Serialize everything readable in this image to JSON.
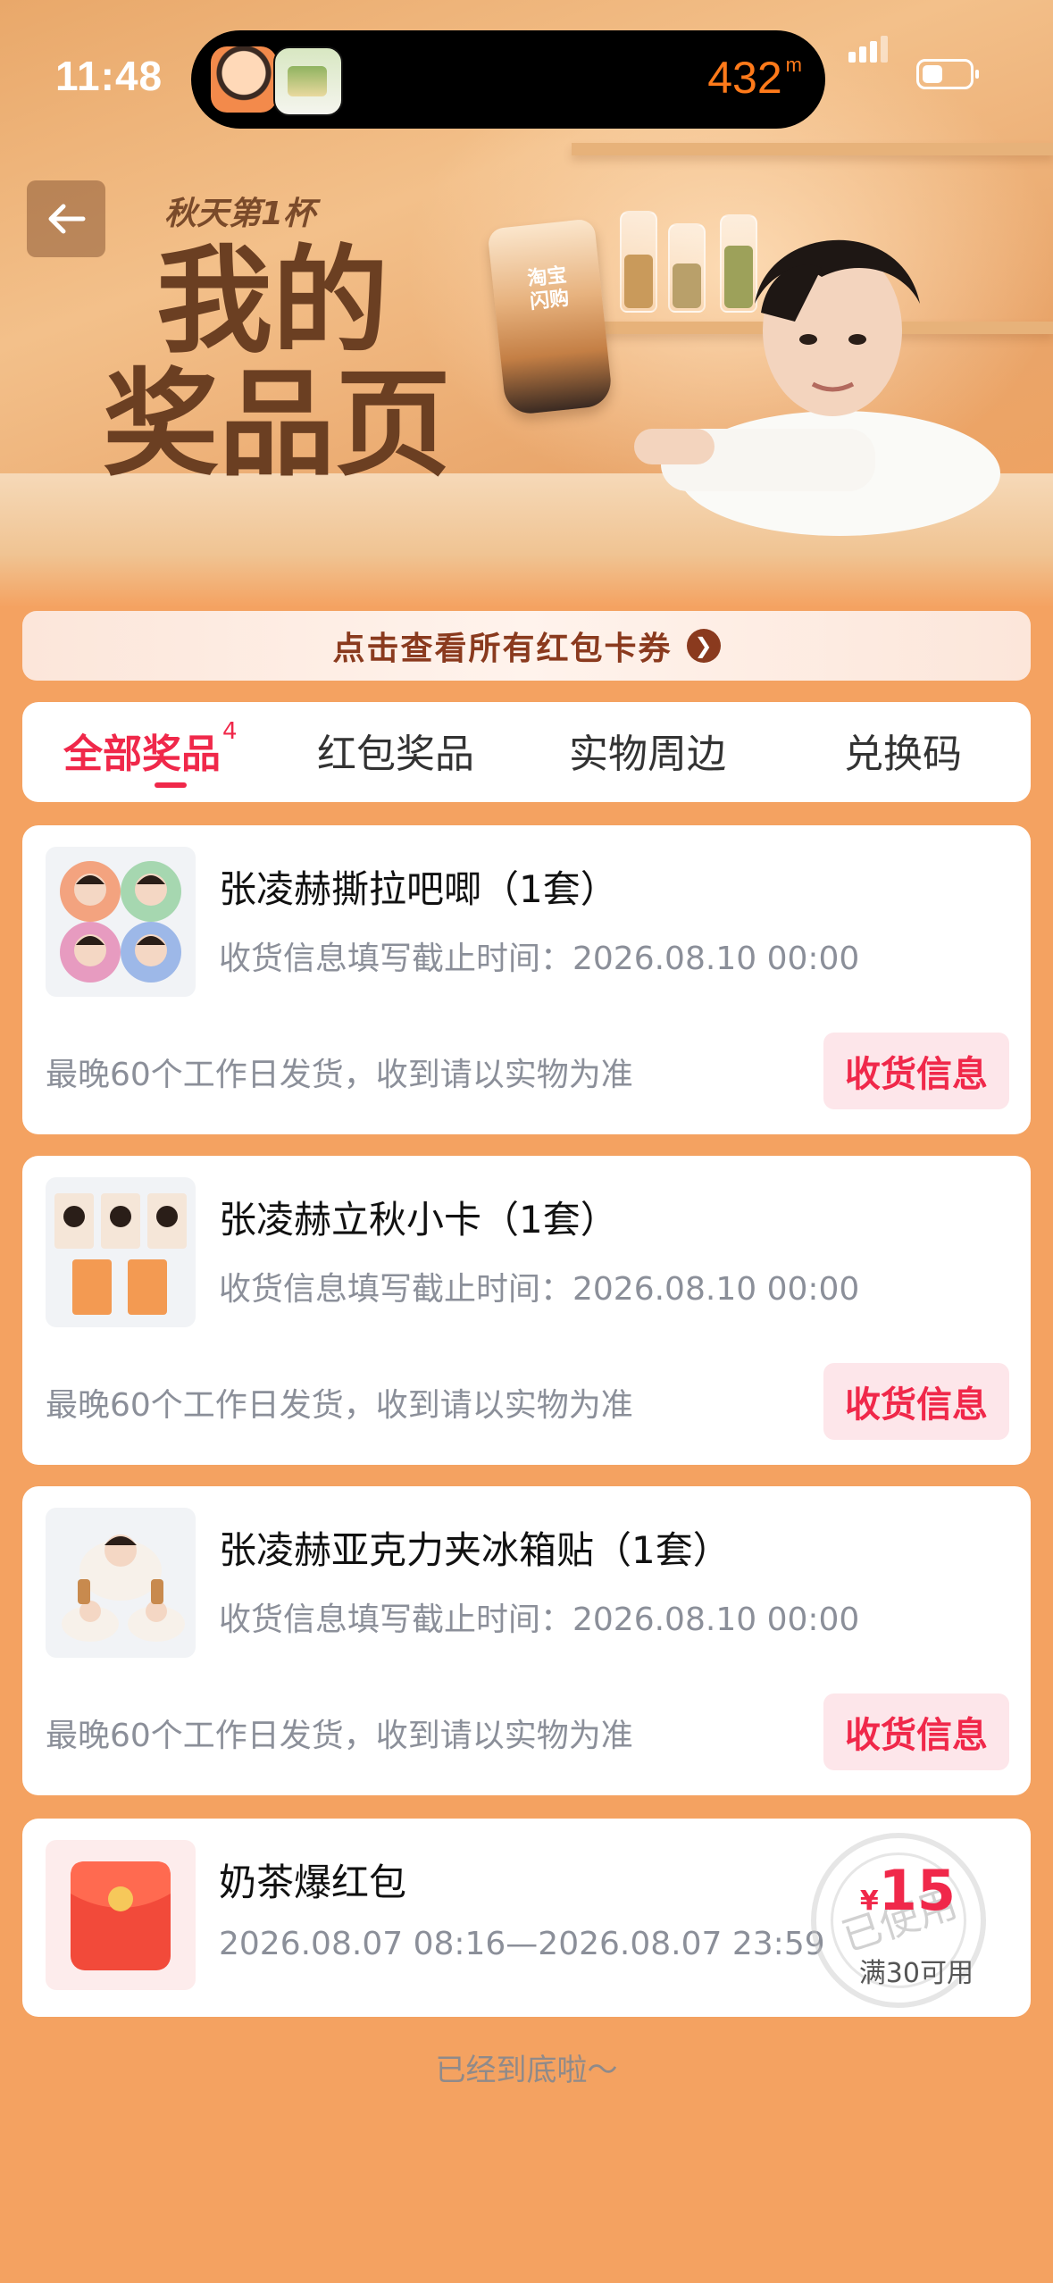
{
  "status_bar": {
    "time": "11:48",
    "distance": "432",
    "distance_unit": "m"
  },
  "hero": {
    "subtitle": "秋天第1杯",
    "title_line1": "我的",
    "title_line2": "奖品页",
    "cup_label_line1": "淘宝",
    "cup_label_line2": "闪购"
  },
  "coupon_banner": {
    "label": "点击查看所有红包卡券"
  },
  "tabs": [
    {
      "label": "全部奖品",
      "badge": "4"
    },
    {
      "label": "红包奖品"
    },
    {
      "label": "实物周边"
    },
    {
      "label": "兑换码"
    }
  ],
  "prizes": [
    {
      "title": "张凌赫撕拉吧唧（1套）",
      "deadline": "收货信息填写截止时间：2026.08.10 00:00",
      "ship_note": "最晚60个工作日发货，收到请以实物为准",
      "button": "收货信息"
    },
    {
      "title": "张凌赫立秋小卡（1套）",
      "deadline": "收货信息填写截止时间：2026.08.10 00:00",
      "ship_note": "最晚60个工作日发货，收到请以实物为准",
      "button": "收货信息"
    },
    {
      "title": "张凌赫亚克力夹冰箱贴（1套）",
      "deadline": "收货信息填写截止时间：2026.08.10 00:00",
      "ship_note": "最晚60个工作日发货，收到请以实物为准",
      "button": "收货信息"
    }
  ],
  "redpacket": {
    "title": "奶茶爆红包",
    "validity": "2026.08.07 08:16—2026.08.07 23:59",
    "currency": "¥",
    "amount": "15",
    "condition": "满30可用",
    "stamp": "已使用"
  },
  "footer": {
    "text": "已经到底啦～"
  },
  "colors": {
    "accent": "#F0284A",
    "page_bg": "#F4A261",
    "banner_text": "#8A3A1E"
  }
}
